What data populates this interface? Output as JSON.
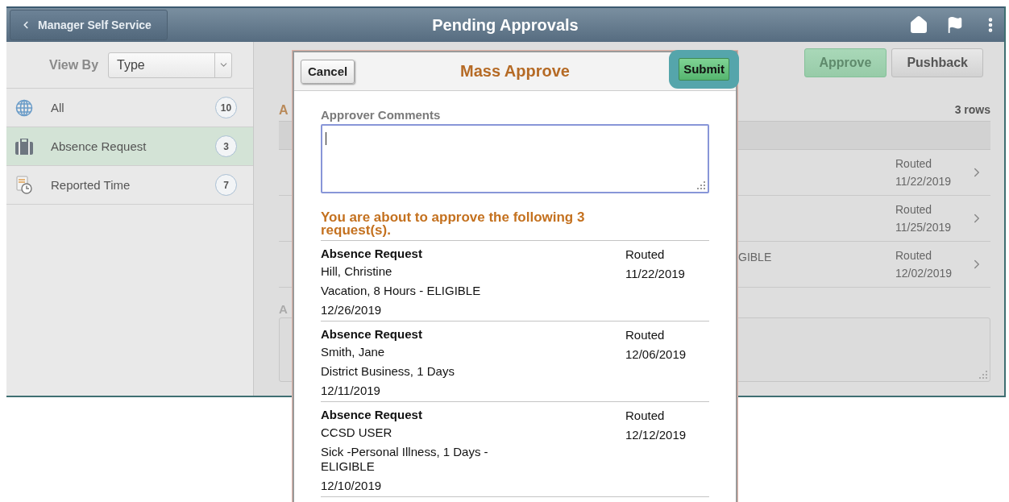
{
  "header": {
    "back_button": "Manager Self Service",
    "title": "Pending Approvals"
  },
  "sidebar": {
    "view_by_label": "View By",
    "view_by_value": "Type",
    "items": [
      {
        "label": "All",
        "count": "10",
        "selected": false,
        "kind": "globe"
      },
      {
        "label": "Absence Request",
        "count": "3",
        "selected": true,
        "kind": "briefcase"
      },
      {
        "label": "Reported Time",
        "count": "7",
        "selected": false,
        "kind": "timesheet"
      }
    ]
  },
  "main": {
    "buttons": [
      {
        "label": "Approve",
        "kind": "primary"
      },
      {
        "label": "Pushback",
        "kind": "secondary"
      }
    ],
    "section_heading": "A",
    "row_count": "3 rows",
    "rows": [
      {
        "status": "Routed",
        "date": "11/22/2019"
      },
      {
        "status": "Routed",
        "date": "11/25/2019"
      },
      {
        "column_1": "GIBLE",
        "status": "Routed",
        "date": "12/02/2019"
      }
    ],
    "comments_label": "A"
  },
  "dialog": {
    "cancel": "Cancel",
    "title": "Mass Approve",
    "submit": "Submit",
    "submit_highlighted": true,
    "comments_label": "Approver Comments",
    "message": "You are about to approve the following 3 request(s).",
    "requests": [
      {
        "type": "Absence Request",
        "name": "Hill, Christine",
        "detail": "Vacation, 8 Hours - ELIGIBLE",
        "date": "12/26/2019",
        "status": "Routed",
        "status_date": "11/22/2019"
      },
      {
        "type": "Absence Request",
        "name": "Smith, Jane",
        "detail": "District Business, 1 Days",
        "date": "12/11/2019",
        "status": "Routed",
        "status_date": "12/06/2019"
      },
      {
        "type": "Absence Request",
        "name": "CCSD USER",
        "detail": "Sick -Personal Illness, 1 Days - ELIGIBLE",
        "date": "12/10/2019",
        "status": "Routed",
        "status_date": "12/12/2019"
      }
    ]
  }
}
